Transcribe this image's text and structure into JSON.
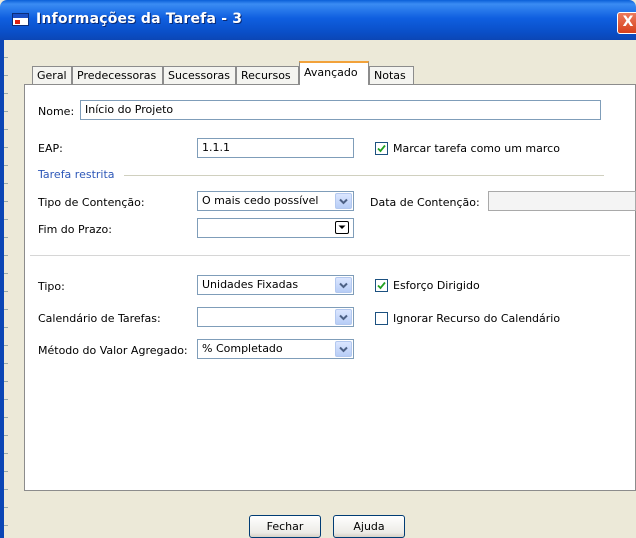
{
  "window": {
    "title": "Informações da Tarefa - 3",
    "close_glyph": "X"
  },
  "tabs": [
    {
      "label": "Geral",
      "active": false
    },
    {
      "label": "Predecessoras",
      "active": false
    },
    {
      "label": "Sucessoras",
      "active": false
    },
    {
      "label": "Recursos",
      "active": false
    },
    {
      "label": "Avançado",
      "active": true
    },
    {
      "label": "Notas",
      "active": false
    }
  ],
  "form": {
    "name_label": "Nome:",
    "name_value": "Início do Projeto",
    "eap_label": "EAP:",
    "eap_value": "1.1.1",
    "milestone_label": "Marcar tarefa como um marco",
    "milestone_checked": true,
    "section_title": "Tarefa restrita",
    "constraint_type_label": "Tipo de Contenção:",
    "constraint_type_value": "O mais cedo possível",
    "constraint_date_label": "Data de Contenção:",
    "constraint_date_value": "",
    "deadline_label": "Fim do Prazo:",
    "deadline_value": "",
    "type_label": "Tipo:",
    "type_value": "Unidades Fixadas",
    "effort_driven_label": "Esforço Dirigido",
    "effort_driven_checked": true,
    "calendar_label": "Calendário de Tarefas:",
    "calendar_value": "",
    "ignore_calendar_label": "Ignorar Recurso do Calendário",
    "ignore_calendar_checked": false,
    "earned_value_label": "Método do Valor Agregado:",
    "earned_value_value": "% Completado"
  },
  "buttons": {
    "close": "Fechar",
    "help": "Ajuda"
  },
  "icons": {
    "dropdown": "chevron-down-icon",
    "check": "check-icon",
    "calendar": "calendar-dropdown-icon",
    "window": "task-window-icon"
  },
  "colors": {
    "title_bar": "#0a5fd8",
    "active_tab_accent": "#f2a23a",
    "section_text": "#2e58b8",
    "close_button": "#d6401c"
  }
}
